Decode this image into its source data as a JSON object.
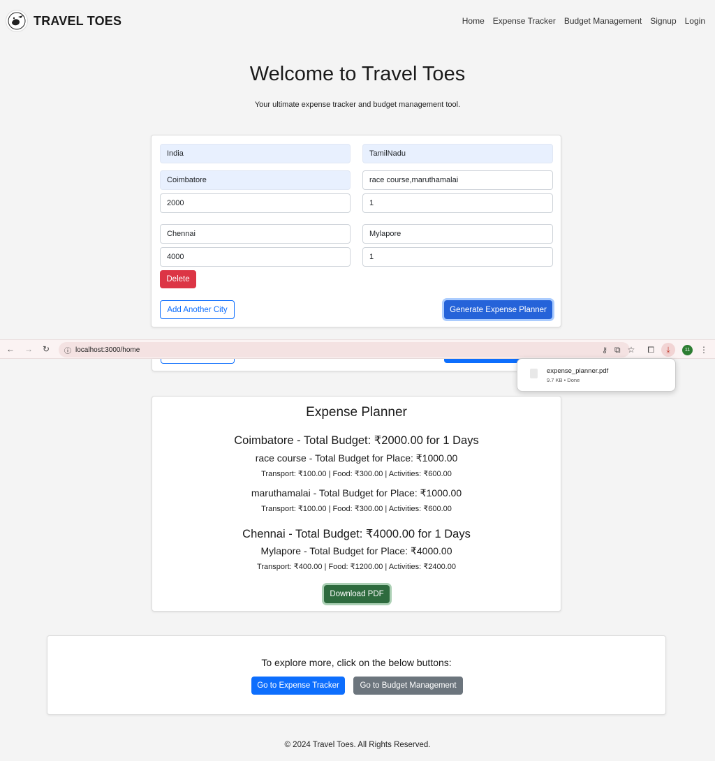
{
  "brand": {
    "name": "TRAVEL TOES",
    "logo_text": "TRAVEL TOES"
  },
  "nav": {
    "items": [
      "Home",
      "Expense Tracker",
      "Budget Management",
      "Signup",
      "Login"
    ]
  },
  "hero": {
    "title": "Welcome to Travel Toes",
    "subtitle": "Your ultimate expense tracker and budget management tool."
  },
  "form": {
    "country": "India",
    "state": "TamilNadu",
    "cities": [
      {
        "city": "Coimbatore",
        "places": "race course,maruthamalai",
        "budget": "2000",
        "days": "1"
      },
      {
        "city": "Chennai",
        "places": "Mylapore",
        "budget": "4000",
        "days": "1"
      }
    ],
    "delete_label": "Delete",
    "add_city_label": "Add Another City",
    "generate_label": "Generate Expense Planner"
  },
  "browser": {
    "url": "localhost:3000/home",
    "extension_count": "11",
    "download": {
      "filename": "expense_planner.pdf",
      "meta": "9.7 KB • Done"
    }
  },
  "planner": {
    "title": "Expense Planner",
    "cities": [
      {
        "heading": "Coimbatore - Total Budget: ₹2000.00 for 1 Days",
        "places": [
          {
            "heading": "race course - Total Budget for Place: ₹1000.00",
            "detail": "Transport: ₹100.00 | Food: ₹300.00 | Activities: ₹600.00"
          },
          {
            "heading": "maruthamalai - Total Budget for Place: ₹1000.00",
            "detail": "Transport: ₹100.00 | Food: ₹300.00 | Activities: ₹600.00"
          }
        ]
      },
      {
        "heading": "Chennai - Total Budget: ₹4000.00 for 1 Days",
        "places": [
          {
            "heading": "Mylapore - Total Budget for Place: ₹4000.00",
            "detail": "Transport: ₹400.00 | Food: ₹1200.00 | Activities: ₹2400.00"
          }
        ]
      }
    ],
    "download_label": "Download PDF"
  },
  "explore": {
    "text": "To explore more, click on the below buttons:",
    "expense_btn": "Go to Expense Tracker",
    "budget_btn": "Go to Budget Management"
  },
  "footer": {
    "text": "© 2024 Travel Toes. All Rights Reserved."
  },
  "colors": {
    "primary": "#0d6efd",
    "danger": "#dc3545",
    "success": "#2e6b3e",
    "secondary": "#6c757d"
  }
}
